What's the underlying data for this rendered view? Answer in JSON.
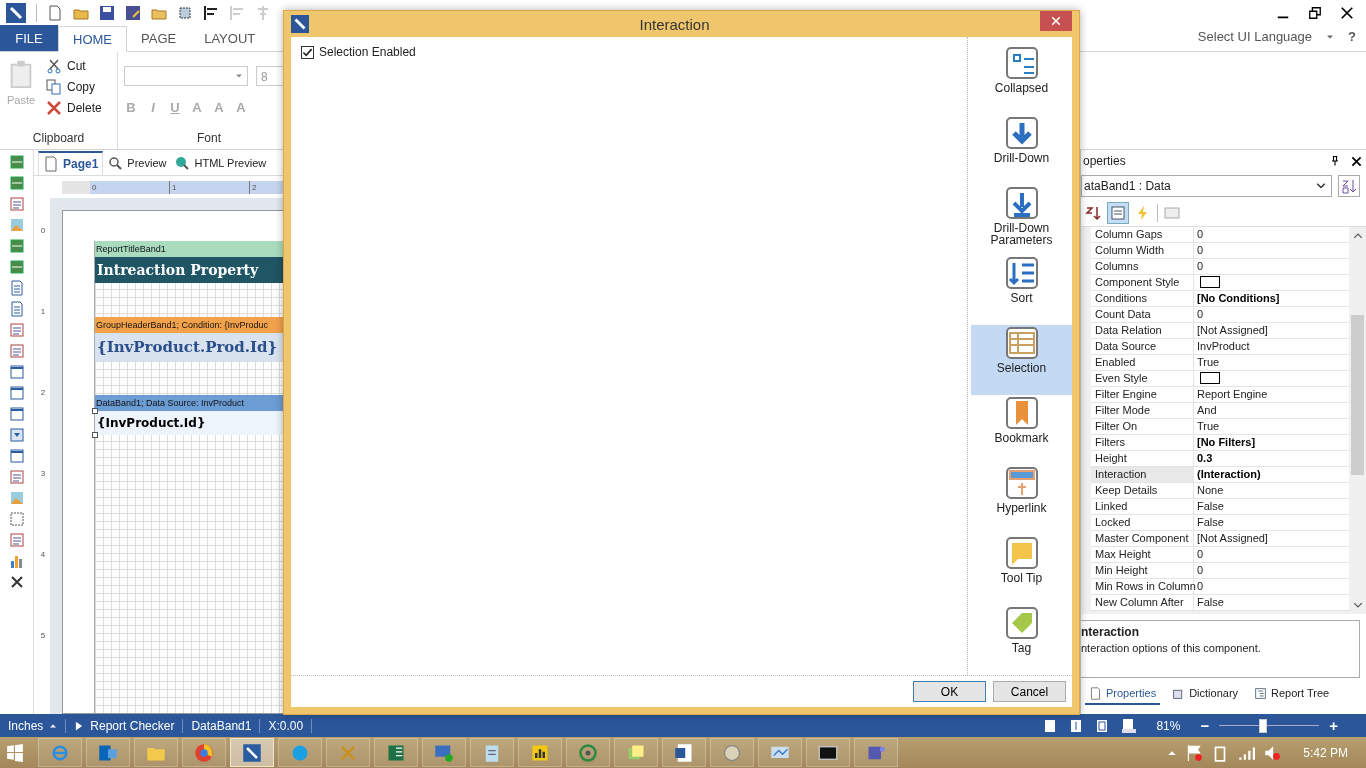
{
  "ribbon": {
    "tabs": [
      {
        "label": "FILE",
        "kind": "file",
        "selected": false
      },
      {
        "label": "HOME",
        "kind": "tab",
        "selected": true
      },
      {
        "label": "PAGE",
        "kind": "tab",
        "selected": false
      },
      {
        "label": "LAYOUT",
        "kind": "tab",
        "selected": false
      }
    ],
    "language": "Select UI Language",
    "help": "?",
    "clipboard": {
      "label": "Clipboard",
      "paste": {
        "label": "Paste",
        "disabled": true
      },
      "actions": [
        {
          "label": "Cut"
        },
        {
          "label": "Copy"
        },
        {
          "label": "Delete"
        }
      ]
    },
    "font": {
      "label": "Font",
      "size": "8",
      "buttons": [
        {
          "label": "B",
          "disabled": true
        },
        {
          "label": "I",
          "disabled": true
        },
        {
          "label": "U",
          "disabled": true
        },
        {
          "label": "A",
          "disabled": true
        },
        {
          "label": "A",
          "disabled": true
        },
        {
          "label": "A",
          "disabled": true
        }
      ]
    }
  },
  "document": {
    "tabs": [
      {
        "label": "Page1",
        "selected": true
      },
      {
        "label": "Preview",
        "selected": false
      },
      {
        "label": "HTML Preview",
        "selected": false
      }
    ],
    "ruler_h": [
      "0",
      "1",
      "2"
    ],
    "ruler_v": [
      "0",
      "1",
      "2",
      "3",
      "4",
      "5"
    ],
    "bands": [
      {
        "kind": "title",
        "header": "ReportTitleBand1",
        "content": "Intreaction Property",
        "selected": false
      },
      {
        "kind": "group",
        "header": "GroupHeaderBand1; Condition: {InvProduc",
        "content": "{InvProduct.Prod.Id}",
        "selected": false
      },
      {
        "kind": "data",
        "header": "DataBand1; Data Source: InvProduct",
        "content": "{InvProduct.Id}",
        "selected": true
      }
    ]
  },
  "properties": {
    "title": "operties",
    "object": "ataBand1 : Data",
    "rows": [
      {
        "name": "Column Gaps",
        "value": "0",
        "kind": "text",
        "selected": false
      },
      {
        "name": "Column Width",
        "value": "0",
        "kind": "text",
        "selected": false
      },
      {
        "name": "Columns",
        "value": "0",
        "kind": "text",
        "selected": false
      },
      {
        "name": "Component Style",
        "kind": "swatch",
        "selected": false
      },
      {
        "name": "Conditions",
        "value": "[No Conditions]",
        "kind": "bold",
        "selected": false
      },
      {
        "name": "Count Data",
        "value": "0",
        "kind": "text",
        "selected": false
      },
      {
        "name": "Data Relation",
        "value": "[Not Assigned]",
        "kind": "text",
        "selected": false
      },
      {
        "name": "Data Source",
        "value": "InvProduct",
        "kind": "text",
        "selected": false
      },
      {
        "name": "Enabled",
        "value": "True",
        "kind": "text",
        "selected": false
      },
      {
        "name": "Even Style",
        "kind": "swatch",
        "selected": false
      },
      {
        "name": "Filter Engine",
        "value": "Report Engine",
        "kind": "text",
        "selected": false
      },
      {
        "name": "Filter Mode",
        "value": "And",
        "kind": "text",
        "selected": false
      },
      {
        "name": "Filter On",
        "value": "True",
        "kind": "text",
        "selected": false
      },
      {
        "name": "Filters",
        "value": "[No Filters]",
        "kind": "bold",
        "selected": false
      },
      {
        "name": "Height",
        "value": "0.3",
        "kind": "bold",
        "selected": false
      },
      {
        "name": "Interaction",
        "value": "(Interaction)",
        "kind": "bold",
        "selected": true
      },
      {
        "name": "Keep Details",
        "value": "None",
        "kind": "text",
        "selected": false
      },
      {
        "name": "Linked",
        "value": "False",
        "kind": "text",
        "selected": false
      },
      {
        "name": "Locked",
        "value": "False",
        "kind": "text",
        "selected": false
      },
      {
        "name": "Master Component",
        "value": "[Not Assigned]",
        "kind": "text",
        "selected": false
      },
      {
        "name": "Max Height",
        "value": "0",
        "kind": "text",
        "selected": false
      },
      {
        "name": "Min Height",
        "value": "0",
        "kind": "text",
        "selected": false
      },
      {
        "name": "Min Rows in Column",
        "value": "0",
        "kind": "text",
        "selected": false
      },
      {
        "name": "New Column After",
        "value": "False",
        "kind": "text",
        "selected": false
      }
    ],
    "description_title": "nteraction",
    "description": "nteraction options of this component.",
    "tabs": [
      {
        "label": "Properties",
        "selected": true
      },
      {
        "label": "Dictionary",
        "selected": false
      },
      {
        "label": "Report Tree",
        "selected": false
      }
    ]
  },
  "status_bar": {
    "units": "Inches",
    "checker": "Report Checker",
    "component": "DataBand1",
    "position": "X:0.00",
    "zoom": "81%",
    "zoom_out": "−",
    "zoom_in": "+",
    "level": 0.44
  },
  "dialog": {
    "title": "Interaction",
    "checkbox": {
      "label": "Selection Enabled",
      "checked": true
    },
    "sections": [
      {
        "label": "Collapsed",
        "selected": false
      },
      {
        "label": "Drill-Down",
        "selected": false
      },
      {
        "label": "Drill-Down Parameters",
        "selected": false
      },
      {
        "label": "Sort",
        "selected": false
      },
      {
        "label": "Selection",
        "selected": true
      },
      {
        "label": "Bookmark",
        "selected": false
      },
      {
        "label": "Hyperlink",
        "selected": false
      },
      {
        "label": "Tool Tip",
        "selected": false
      },
      {
        "label": "Tag",
        "selected": false
      }
    ],
    "buttons": [
      {
        "label": "OK",
        "kind": "default"
      },
      {
        "label": "Cancel",
        "kind": "normal"
      }
    ]
  },
  "taskbar": {
    "apps": [
      {
        "selected": false
      },
      {
        "selected": false
      },
      {
        "selected": false
      },
      {
        "selected": false
      },
      {
        "selected": true
      },
      {
        "selected": false
      },
      {
        "selected": false
      },
      {
        "selected": false
      },
      {
        "selected": false
      },
      {
        "selected": false
      },
      {
        "selected": false
      },
      {
        "selected": false
      },
      {
        "selected": false
      },
      {
        "selected": false
      },
      {
        "selected": false
      },
      {
        "selected": false
      },
      {
        "selected": false
      },
      {
        "selected": false
      }
    ],
    "time": "5:42 PM"
  }
}
